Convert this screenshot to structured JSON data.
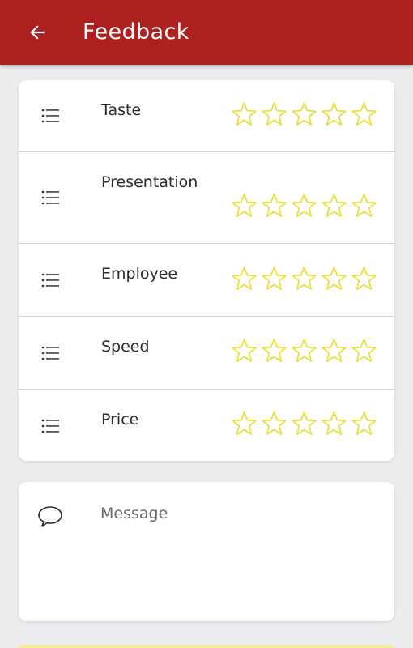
{
  "header": {
    "title": "Feedback",
    "back_icon": "arrow-left-icon",
    "background": "#ad2020"
  },
  "ratings": {
    "max_stars": 5,
    "star_color": "#e8e035",
    "items": [
      {
        "label": "Taste",
        "icon": "list-icon",
        "rating": 0
      },
      {
        "label": "Presentation",
        "icon": "list-icon",
        "rating": 0
      },
      {
        "label": "Employee",
        "icon": "list-icon",
        "rating": 0
      },
      {
        "label": "Speed",
        "icon": "list-icon",
        "rating": 0
      },
      {
        "label": "Price",
        "icon": "list-icon",
        "rating": 0
      }
    ]
  },
  "message": {
    "icon": "chat-bubble-icon",
    "placeholder": "Message",
    "value": ""
  }
}
